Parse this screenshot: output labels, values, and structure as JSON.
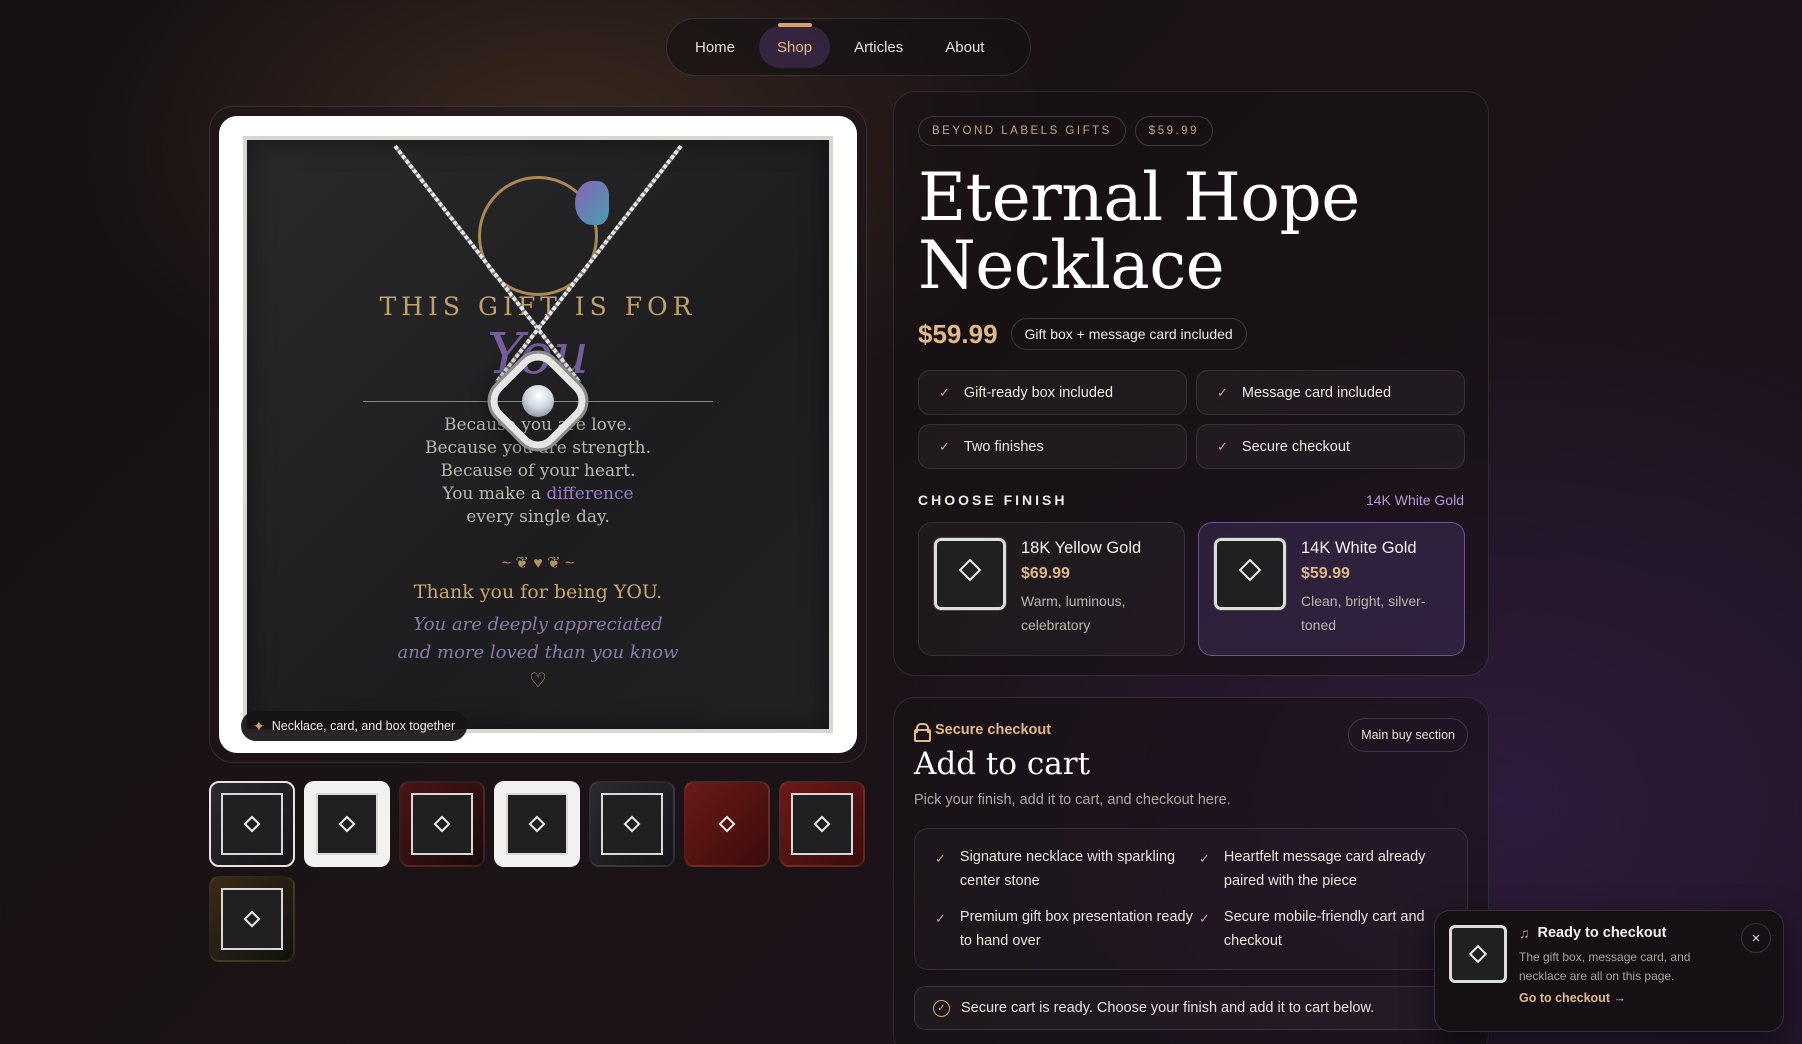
{
  "nav": {
    "items": [
      {
        "label": "Home",
        "active": false
      },
      {
        "label": "Shop",
        "active": true
      },
      {
        "label": "Articles",
        "active": false
      },
      {
        "label": "About",
        "active": false
      }
    ]
  },
  "gallery": {
    "card_text": {
      "headline": "THIS GIFT IS FOR",
      "you": "You",
      "line1": "Because you are love.",
      "line2": "Because you are strength.",
      "line3": "Because of your heart.",
      "line4a": "You make a ",
      "line4b": "difference",
      "line5": "every single day.",
      "thanks": "Thank you for being YOU.",
      "script1": "You are deeply appreciated",
      "script2": "and more loved than you know"
    },
    "caption": "Necklace, card, and box together",
    "thumbnail_count": 8,
    "active_thumbnail": 1
  },
  "product": {
    "brand_chip": "BEYOND LABELS GIFTS",
    "price_chip": "$59.99",
    "title": "Eternal Hope Necklace",
    "price": "$59.99",
    "price_note": "Gift box + message card included",
    "features": [
      "Gift-ready box included",
      "Message card included",
      "Two finishes",
      "Secure checkout"
    ],
    "finish": {
      "label": "CHOOSE FINISH",
      "selected": "14K White Gold",
      "options": [
        {
          "name": "18K Yellow Gold",
          "price": "$69.99",
          "desc": "Warm, luminous, celebratory",
          "active": false
        },
        {
          "name": "14K White Gold",
          "price": "$59.99",
          "desc": "Clean, bright, silver-toned",
          "active": true
        }
      ]
    }
  },
  "cart": {
    "secure_label": "Secure checkout",
    "main_buy_chip": "Main buy section",
    "title": "Add to cart",
    "subtitle": "Pick your finish, add it to cart, and checkout here.",
    "includes": [
      "Signature necklace with sparkling center stone",
      "Heartfelt message card already paired with the piece",
      "Premium gift box presentation ready to hand over",
      "Secure mobile-friendly cart and checkout"
    ],
    "status": "Secure cart is ready. Choose your finish and add it to cart below."
  },
  "toast": {
    "title": "Ready to checkout",
    "text": "The gift box, message card, and necklace are all on this page.",
    "link": "Go to checkout",
    "close": "×"
  },
  "colors": {
    "accent_gold": "#e3b98a",
    "accent_purple": "#b59ad6",
    "background": "#171114"
  },
  "icons": {
    "check": "✓",
    "sparkle": "✦",
    "bell": "🔔",
    "arrow_right": "→"
  }
}
